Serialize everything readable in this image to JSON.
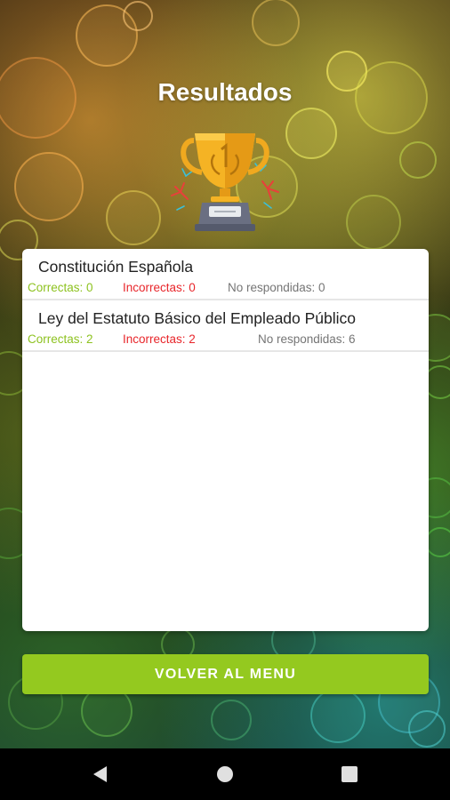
{
  "screen": {
    "title": "Resultados",
    "trophy_icon": "trophy-icon"
  },
  "results": [
    {
      "title": "Constitución Española",
      "correct": "Correctas: 0",
      "incorrect": "Incorrectas: 0",
      "unanswered": "No respondidas: 0"
    },
    {
      "title": "Ley del Estatuto Básico del Empleado Público",
      "correct": "Correctas: 2",
      "incorrect": "Incorrectas: 2",
      "unanswered": "No respondidas: 6"
    }
  ],
  "button": {
    "label": "VOLVER AL MENU"
  },
  "nav": {
    "back_icon": "back-triangle-icon",
    "home_icon": "home-circle-icon",
    "recents_icon": "recents-square-icon"
  },
  "colors": {
    "correct": "#8dc21f",
    "incorrect": "#e8262b",
    "unanswered": "#757575",
    "button": "#94c91f"
  }
}
